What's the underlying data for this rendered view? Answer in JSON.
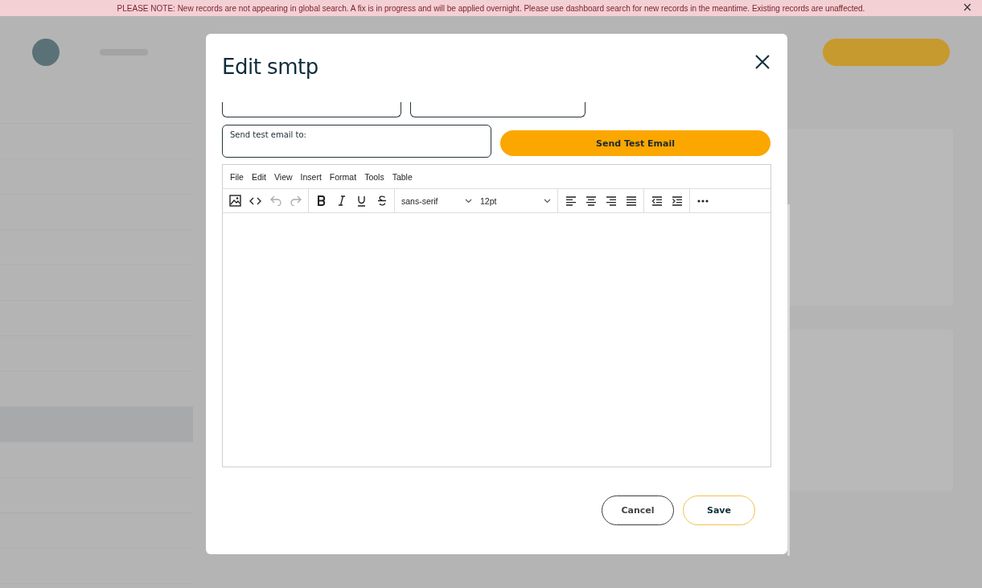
{
  "notice": {
    "text": "PLEASE NOTE: New records are not appearing in global search. A fix is in progress and will be applied overnight. Please use dashboard search for new records in the meantime. Existing records are unaffected.",
    "close": "×"
  },
  "dialog": {
    "title": "Edit smtp",
    "test_email": {
      "placeholder": "Send test email to:"
    },
    "send_button": "Send Test Email",
    "editor": {
      "menu": [
        "File",
        "Edit",
        "View",
        "Insert",
        "Format",
        "Tools",
        "Table"
      ],
      "undo": {
        "disabled": true
      },
      "redo": {
        "disabled": true
      },
      "font_family": "sans-serif",
      "font_size": "12pt"
    },
    "buttons": [
      {
        "label": "Cancel",
        "kind": "secondary"
      },
      {
        "label": "Save",
        "kind": "primary"
      }
    ]
  }
}
